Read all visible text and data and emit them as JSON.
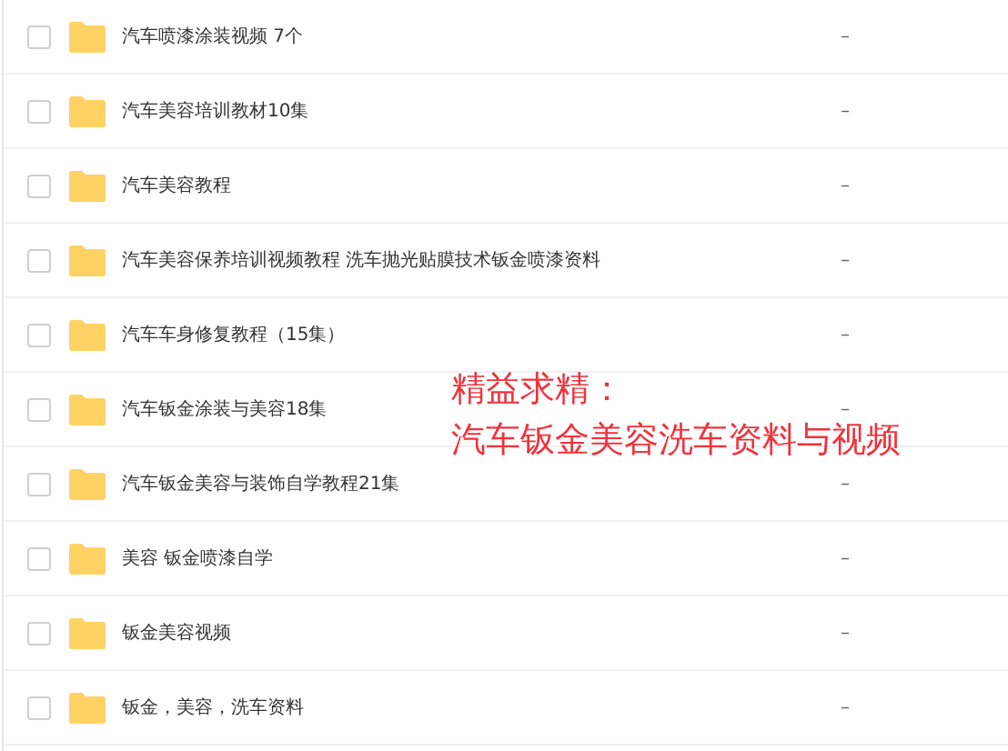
{
  "files": [
    {
      "name": "汽车喷漆涂装视频 7个",
      "checked": false,
      "size": "–"
    },
    {
      "name": "汽车美容培训教材10集",
      "checked": false,
      "size": "–"
    },
    {
      "name": "汽车美容教程",
      "checked": false,
      "size": "–"
    },
    {
      "name": "汽车美容保养培训视频教程 洗车抛光贴膜技术钣金喷漆资料",
      "checked": false,
      "size": "–"
    },
    {
      "name": "汽车车身修复教程（15集）",
      "checked": false,
      "size": "–"
    },
    {
      "name": "汽车钣金涂装与美容18集",
      "checked": false,
      "size": "–"
    },
    {
      "name": "汽车钣金美容与装饰自学教程21集",
      "checked": false,
      "size": "–"
    },
    {
      "name": "美容 钣金喷漆自学",
      "checked": false,
      "size": "–"
    },
    {
      "name": "钣金美容视频",
      "checked": false,
      "size": "–"
    },
    {
      "name": "钣金，美容，洗车资料",
      "checked": false,
      "size": "–"
    }
  ],
  "overlay": [
    "精益求精：",
    "汽车钣金美容洗车资料与视频"
  ]
}
